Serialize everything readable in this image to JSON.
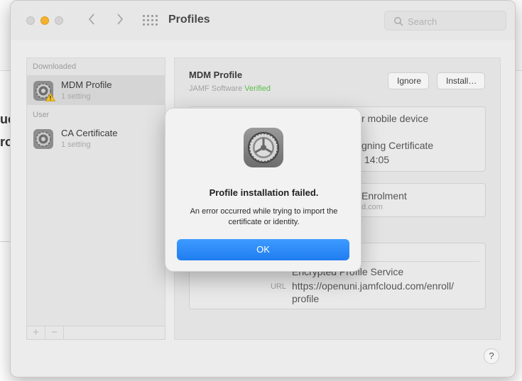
{
  "background": {
    "fragments": [
      "ue",
      "ro"
    ]
  },
  "window": {
    "title": "Profiles",
    "search": {
      "placeholder": "Search"
    },
    "help_label": "?"
  },
  "sidebar": {
    "sections": [
      {
        "label": "Downloaded"
      },
      {
        "label": "User"
      }
    ],
    "items": [
      {
        "name": "MDM Profile",
        "sub": "1 setting",
        "selected": true,
        "warning": true
      },
      {
        "name": "CA Certificate",
        "sub": "1 setting",
        "selected": false,
        "warning": false
      }
    ],
    "footer": {
      "add_label": "+",
      "remove_label": "−"
    }
  },
  "detail": {
    "title": "MDM Profile",
    "org": "JAMF Software",
    "verified": "Verified",
    "ignore_label": "Ignore",
    "install_label": "Install…",
    "card1": {
      "line1": "r mobile device",
      "line2": "gning Certificate",
      "line3": "14:05"
    },
    "card2": {
      "line1": "Enrolment",
      "line2": "d.com"
    },
    "card3": {
      "line1": "Encrypted Profile Service",
      "url_label": "URL",
      "url_value_1": "https://openuni.jamfcloud.com/enroll/",
      "url_value_2": "profile"
    }
  },
  "dialog": {
    "title": "Profile installation failed.",
    "message": "An error occurred while trying to import the certificate or identity.",
    "ok_label": "OK",
    "icon": "gear-icon"
  },
  "colors": {
    "accent": "#1f7df0",
    "verified": "#5bbd4a",
    "warning": "#f2c12e"
  }
}
